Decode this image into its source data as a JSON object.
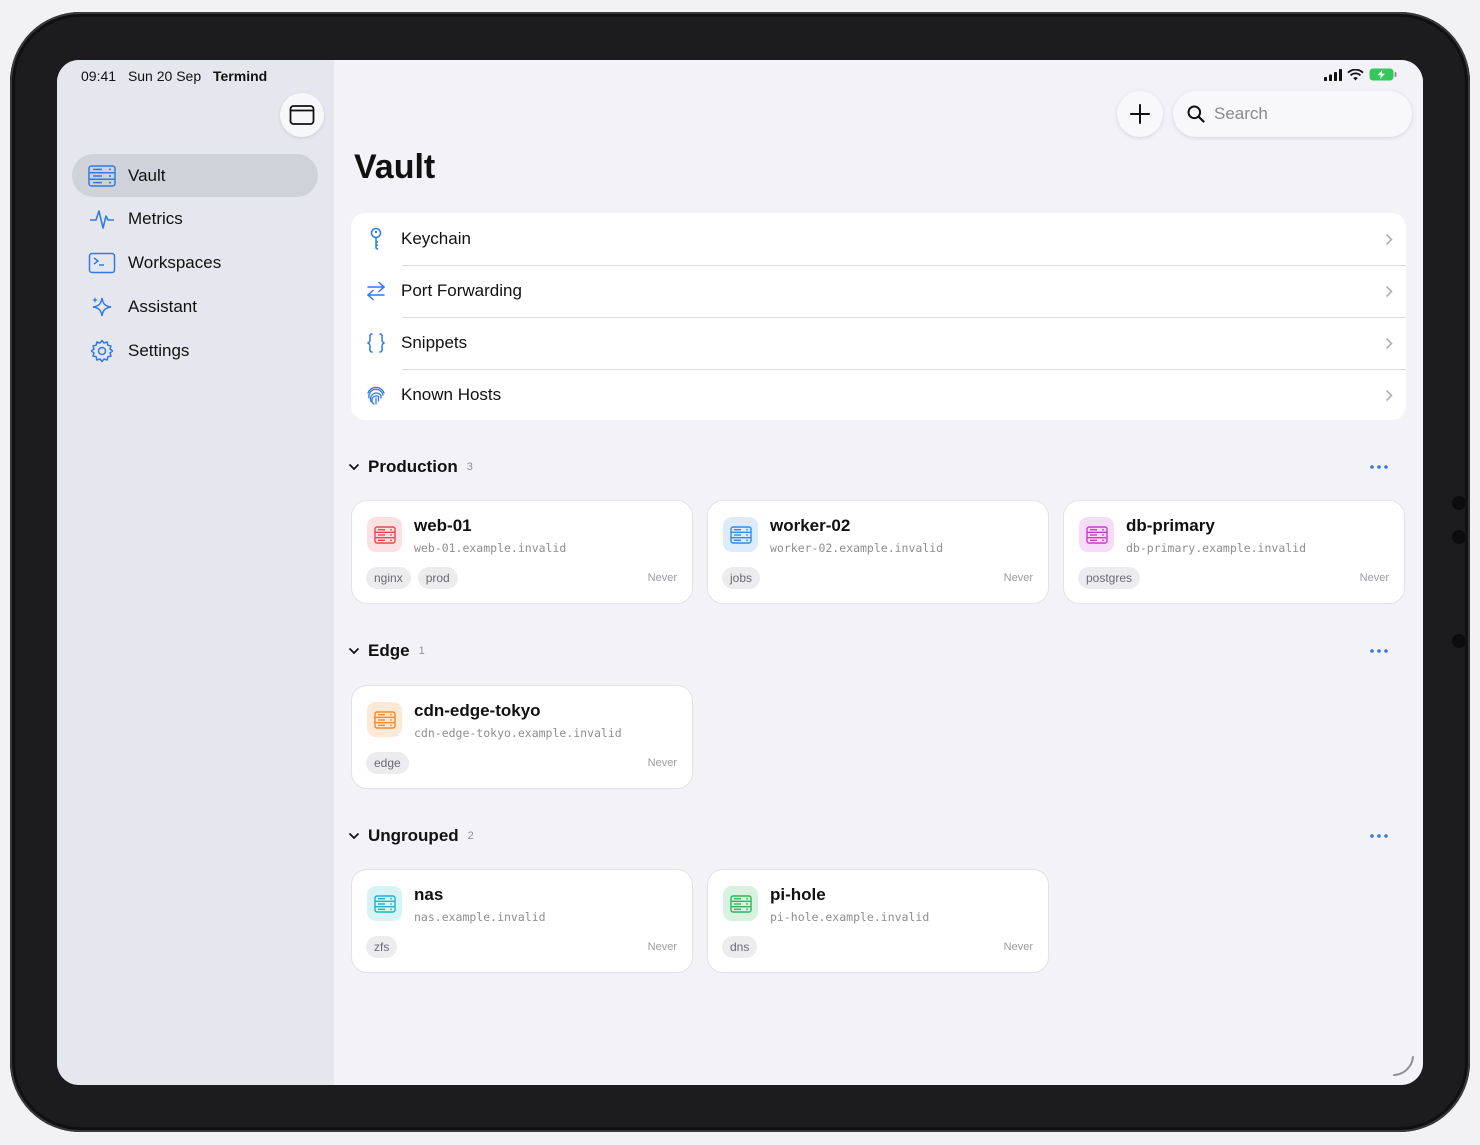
{
  "status_bar": {
    "time": "09:41",
    "date": "Sun 20 Sep",
    "app": "Termind"
  },
  "sidebar": {
    "items": [
      {
        "label": "Vault",
        "icon": "server-rack-icon",
        "active": true
      },
      {
        "label": "Metrics",
        "icon": "waveform-icon",
        "active": false
      },
      {
        "label": "Workspaces",
        "icon": "terminal-window-icon",
        "active": false
      },
      {
        "label": "Assistant",
        "icon": "sparkles-icon",
        "active": false
      },
      {
        "label": "Settings",
        "icon": "gear-icon",
        "active": false
      }
    ]
  },
  "search": {
    "placeholder": "Search"
  },
  "page": {
    "title": "Vault"
  },
  "menu": [
    {
      "label": "Keychain",
      "icon": "key-icon"
    },
    {
      "label": "Port Forwarding",
      "icon": "arrows-left-right-icon"
    },
    {
      "label": "Snippets",
      "icon": "braces-icon"
    },
    {
      "label": "Known Hosts",
      "icon": "fingerprint-icon"
    }
  ],
  "groups": [
    {
      "name": "Production",
      "count": "3",
      "hosts": [
        {
          "name": "web-01",
          "address": "web-01.example.invalid",
          "tags": [
            "nginx",
            "prod"
          ],
          "last": "Never",
          "color": "#e8474c",
          "bg": "#fde1e2"
        },
        {
          "name": "worker-02",
          "address": "worker-02.example.invalid",
          "tags": [
            "jobs"
          ],
          "last": "Never",
          "color": "#2f8be6",
          "bg": "#dcecfb"
        },
        {
          "name": "db-primary",
          "address": "db-primary.example.invalid",
          "tags": [
            "postgres"
          ],
          "last": "Never",
          "color": "#c43fc6",
          "bg": "#f6dcf6"
        }
      ]
    },
    {
      "name": "Edge",
      "count": "1",
      "hosts": [
        {
          "name": "cdn-edge-tokyo",
          "address": "cdn-edge-tokyo.example.invalid",
          "tags": [
            "edge"
          ],
          "last": "Never",
          "color": "#ef8a2b",
          "bg": "#fde9d5"
        }
      ]
    },
    {
      "name": "Ungrouped",
      "count": "2",
      "hosts": [
        {
          "name": "nas",
          "address": "nas.example.invalid",
          "tags": [
            "zfs"
          ],
          "last": "Never",
          "color": "#1fb3c4",
          "bg": "#d6f3f6"
        },
        {
          "name": "pi-hole",
          "address": "pi-hole.example.invalid",
          "tags": [
            "dns"
          ],
          "last": "Never",
          "color": "#2fb55a",
          "bg": "#d9f2e0"
        }
      ]
    }
  ],
  "colors": {
    "accent": "#2f7ae5",
    "battery": "#34c759"
  }
}
